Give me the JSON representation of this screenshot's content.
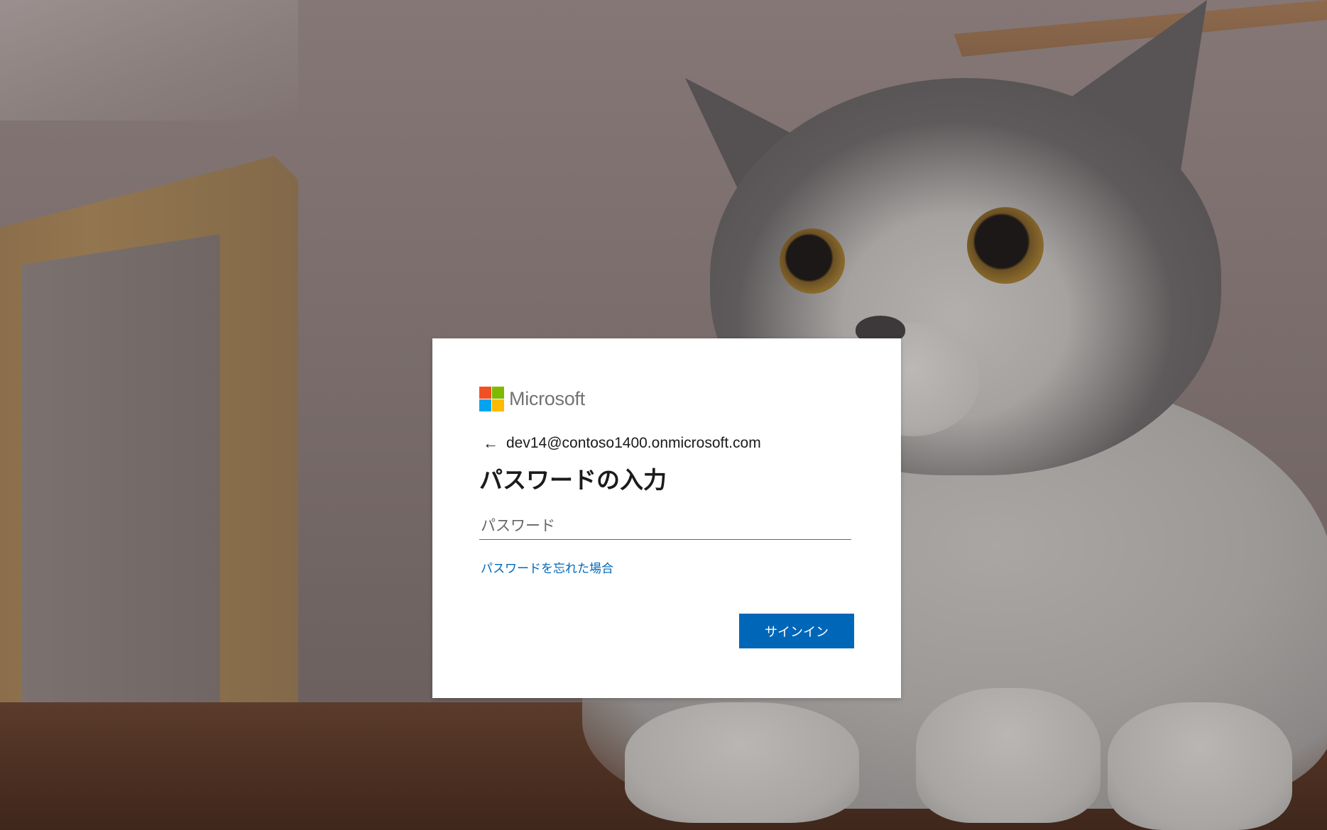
{
  "brand": {
    "name": "Microsoft",
    "logo_colors": [
      "#f25022",
      "#7fba00",
      "#00a4ef",
      "#ffb900"
    ]
  },
  "identity": {
    "back_icon": "arrow-left-icon",
    "email": "dev14@contoso1400.onmicrosoft.com"
  },
  "title": "パスワードの入力",
  "password": {
    "placeholder": "パスワード",
    "value": ""
  },
  "forgot_link": "パスワードを忘れた場合",
  "signin_button": "サインイン",
  "colors": {
    "accent": "#0067b8",
    "card_bg": "#ffffff",
    "text": "#1b1b1b"
  },
  "background": {
    "description_icon": "cat-photo-background"
  }
}
